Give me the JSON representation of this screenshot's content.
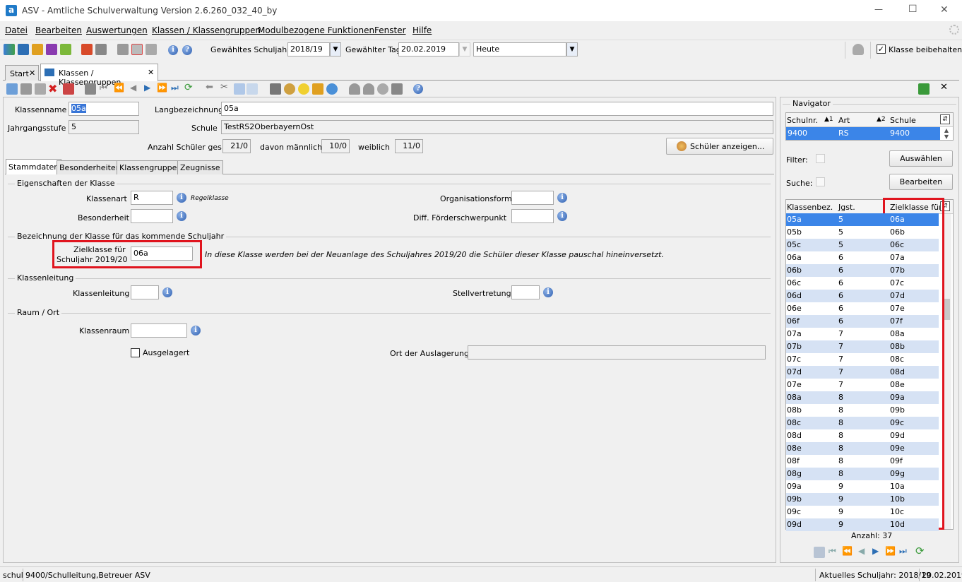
{
  "window": {
    "title": "ASV - Amtliche Schulverwaltung Version 2.6.260_032_40_by",
    "minimize": "—",
    "maximize": "☐",
    "close": "✕"
  },
  "menu": [
    "Datei",
    "Bearbeiten",
    "Auswertungen",
    "Klassen / Klassengruppen",
    "Modulbezogene Funktionen",
    "Fenster",
    "Hilfe"
  ],
  "toolbar": {
    "schuljahr_label": "Gewähltes Schuljahr",
    "schuljahr_value": "2018/19",
    "tag_label": "Gewählter Tag",
    "tag_value": "20.02.2019",
    "heute_value": "Heute",
    "klasse_beibehalten": "Klasse beibehalten"
  },
  "doc_tabs": [
    {
      "label": "Start",
      "close": "✕"
    },
    {
      "label": "Klassen / Klassengruppen",
      "close": "✕"
    }
  ],
  "header": {
    "klassenname_label": "Klassenname",
    "klassenname_value": "05a",
    "langbezeichnung_label": "Langbezeichnung",
    "langbezeichnung_value": "05a",
    "jahrgangsstufe_label": "Jahrgangsstufe",
    "jahrgangsstufe_value": "5",
    "schule_label": "Schule",
    "schule_value": "TestRS2OberbayernOst",
    "anzahl_label": "Anzahl Schüler ges.",
    "anzahl_value": "21/0",
    "maennlich_label": "davon männlich",
    "maennlich_value": "10/0",
    "weiblich_label": "weiblich",
    "weiblich_value": "11/0",
    "schueler_button": "Schüler anzeigen..."
  },
  "form_tabs": [
    "Stammdaten",
    "Besonderheiten",
    "Klassengruppen",
    "Zeugnisse"
  ],
  "eigenschaften": {
    "title": "Eigenschaften der Klasse",
    "klassenart_label": "Klassenart",
    "klassenart_value": "R",
    "klassenart_hint": "Regelklasse",
    "organisationsform_label": "Organisationsform",
    "besonderheit_label": "Besonderheit",
    "diff_label": "Diff. Förderschwerpunkt"
  },
  "bezeichnung": {
    "title": "Bezeichnung der Klasse für das kommende Schuljahr",
    "zielklasse_label_1": "Zielklasse für",
    "zielklasse_label_2": "Schuljahr 2019/20",
    "zielklasse_value": "06a",
    "hint": "In diese Klasse werden bei der Neuanlage des Schuljahres 2019/20 die Schüler dieser Klasse pauschal hineinversetzt."
  },
  "klassenleitung": {
    "title": "Klassenleitung",
    "klassenleitung_label": "Klassenleitung",
    "stellvertretung_label": "Stellvertretung"
  },
  "raum": {
    "title": "Raum / Ort",
    "klassenraum_label": "Klassenraum",
    "ausgelagert_label": "Ausgelagert",
    "ort_label": "Ort der Auslagerung"
  },
  "navigator": {
    "title": "Navigator",
    "school_headers": [
      "Schulnr.",
      "Art",
      "Schule"
    ],
    "school_sort": [
      "▲1",
      "▲2"
    ],
    "school_row": [
      "9400",
      "RS",
      "9400"
    ],
    "filter_label": "Filter:",
    "suche_label": "Suche:",
    "auswaehlen_button": "Auswählen",
    "bearbeiten_button": "Bearbeiten",
    "class_headers": [
      "Klassenbez.",
      "Jgst.",
      "Zielklasse für..."
    ],
    "classes": [
      [
        "05a",
        "5",
        "06a"
      ],
      [
        "05b",
        "5",
        "06b"
      ],
      [
        "05c",
        "5",
        "06c"
      ],
      [
        "06a",
        "6",
        "07a"
      ],
      [
        "06b",
        "6",
        "07b"
      ],
      [
        "06c",
        "6",
        "07c"
      ],
      [
        "06d",
        "6",
        "07d"
      ],
      [
        "06e",
        "6",
        "07e"
      ],
      [
        "06f",
        "6",
        "07f"
      ],
      [
        "07a",
        "7",
        "08a"
      ],
      [
        "07b",
        "7",
        "08b"
      ],
      [
        "07c",
        "7",
        "08c"
      ],
      [
        "07d",
        "7",
        "08d"
      ],
      [
        "07e",
        "7",
        "08e"
      ],
      [
        "08a",
        "8",
        "09a"
      ],
      [
        "08b",
        "8",
        "09b"
      ],
      [
        "08c",
        "8",
        "09c"
      ],
      [
        "08d",
        "8",
        "09d"
      ],
      [
        "08e",
        "8",
        "09e"
      ],
      [
        "08f",
        "8",
        "09f"
      ],
      [
        "08g",
        "8",
        "09g"
      ],
      [
        "09a",
        "9",
        "10a"
      ],
      [
        "09b",
        "9",
        "10b"
      ],
      [
        "09c",
        "9",
        "10c"
      ],
      [
        "09d",
        "9",
        "10d"
      ]
    ],
    "anzahl": "Anzahl: 37"
  },
  "statusbar": {
    "user_short": "schul",
    "user": "9400/Schulleitung,Betreuer ASV",
    "schuljahr": "Aktuelles Schuljahr: 2018/19",
    "datum": "20.02.2019"
  }
}
